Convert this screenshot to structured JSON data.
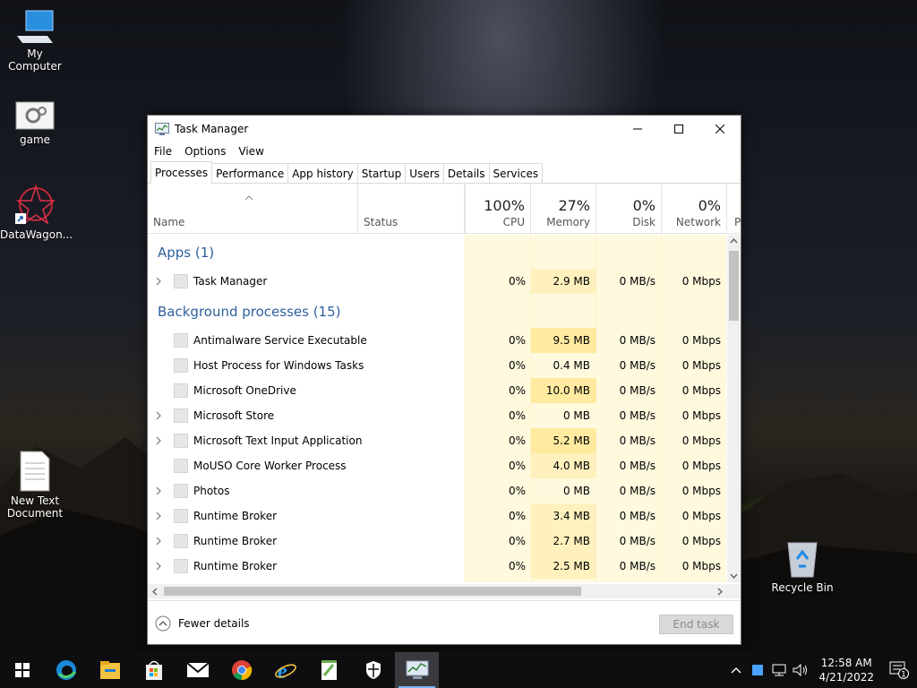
{
  "desktop": {
    "icons": [
      {
        "label": "My Computer",
        "icon": "my-computer-icon"
      },
      {
        "label": "game",
        "icon": "settings-file-icon"
      },
      {
        "label": "DataWagon...",
        "icon": "datawagon-shortcut-icon"
      },
      {
        "label": "New Text Document",
        "icon": "text-document-icon"
      },
      {
        "label": "Recycle Bin",
        "icon": "recycle-bin-icon"
      }
    ]
  },
  "window": {
    "title": "Task Manager",
    "menu": [
      "File",
      "Options",
      "View"
    ],
    "tabs": [
      "Processes",
      "Performance",
      "App history",
      "Startup",
      "Users",
      "Details",
      "Services"
    ],
    "active_tab": "Processes",
    "columns": {
      "name": "Name",
      "status": "Status",
      "cpu": {
        "pct": "100%",
        "label": "CPU"
      },
      "memory": {
        "pct": "27%",
        "label": "Memory"
      },
      "disk": {
        "pct": "0%",
        "label": "Disk"
      },
      "network": {
        "pct": "0%",
        "label": "Network"
      },
      "power": "P"
    },
    "groups": {
      "apps": "Apps (1)",
      "background": "Background processes (15)"
    },
    "apps": [
      {
        "name": "Task Manager",
        "cpu": "0%",
        "memory": "2.9 MB",
        "disk": "0 MB/s",
        "network": "0 Mbps",
        "expandable": true
      }
    ],
    "background": [
      {
        "name": "Antimalware Service Executable",
        "cpu": "0%",
        "memory": "9.5 MB",
        "disk": "0 MB/s",
        "network": "0 Mbps",
        "expandable": false
      },
      {
        "name": "Host Process for Windows Tasks",
        "cpu": "0%",
        "memory": "0.4 MB",
        "disk": "0 MB/s",
        "network": "0 Mbps",
        "expandable": false
      },
      {
        "name": "Microsoft OneDrive",
        "cpu": "0%",
        "memory": "10.0 MB",
        "disk": "0 MB/s",
        "network": "0 Mbps",
        "expandable": false
      },
      {
        "name": "Microsoft Store",
        "cpu": "0%",
        "memory": "0 MB",
        "disk": "0 MB/s",
        "network": "0 Mbps",
        "expandable": true
      },
      {
        "name": "Microsoft Text Input Application",
        "cpu": "0%",
        "memory": "5.2 MB",
        "disk": "0 MB/s",
        "network": "0 Mbps",
        "expandable": true
      },
      {
        "name": "MoUSO Core Worker Process",
        "cpu": "0%",
        "memory": "4.0 MB",
        "disk": "0 MB/s",
        "network": "0 Mbps",
        "expandable": false
      },
      {
        "name": "Photos",
        "cpu": "0%",
        "memory": "0 MB",
        "disk": "0 MB/s",
        "network": "0 Mbps",
        "expandable": true
      },
      {
        "name": "Runtime Broker",
        "cpu": "0%",
        "memory": "3.4 MB",
        "disk": "0 MB/s",
        "network": "0 Mbps",
        "expandable": true
      },
      {
        "name": "Runtime Broker",
        "cpu": "0%",
        "memory": "2.7 MB",
        "disk": "0 MB/s",
        "network": "0 Mbps",
        "expandable": true
      },
      {
        "name": "Runtime Broker",
        "cpu": "0%",
        "memory": "2.5 MB",
        "disk": "0 MB/s",
        "network": "0 Mbps",
        "expandable": true
      }
    ],
    "footer": {
      "fewer_details": "Fewer details",
      "end_task": "End task"
    }
  },
  "taskbar": {
    "apps": [
      "start-icon",
      "edge-icon",
      "file-explorer-icon",
      "store-icon",
      "mail-icon",
      "chrome-icon",
      "internet-explorer-icon",
      "notepad-plus-plus-icon",
      "security-shield-icon",
      "task-manager-icon"
    ],
    "active_app": "task-manager-icon",
    "clock_time": "12:58 AM",
    "clock_date": "4/21/2022",
    "notification_count": "1"
  },
  "colors": {
    "group_text": "#2e5f9e",
    "heat_light": "#fff9de",
    "heat_mid": "#fff4c4",
    "heat_strong": "#ffeaa0",
    "taskbar_bg": "#0e0e10",
    "accent": "#77b5f0"
  }
}
